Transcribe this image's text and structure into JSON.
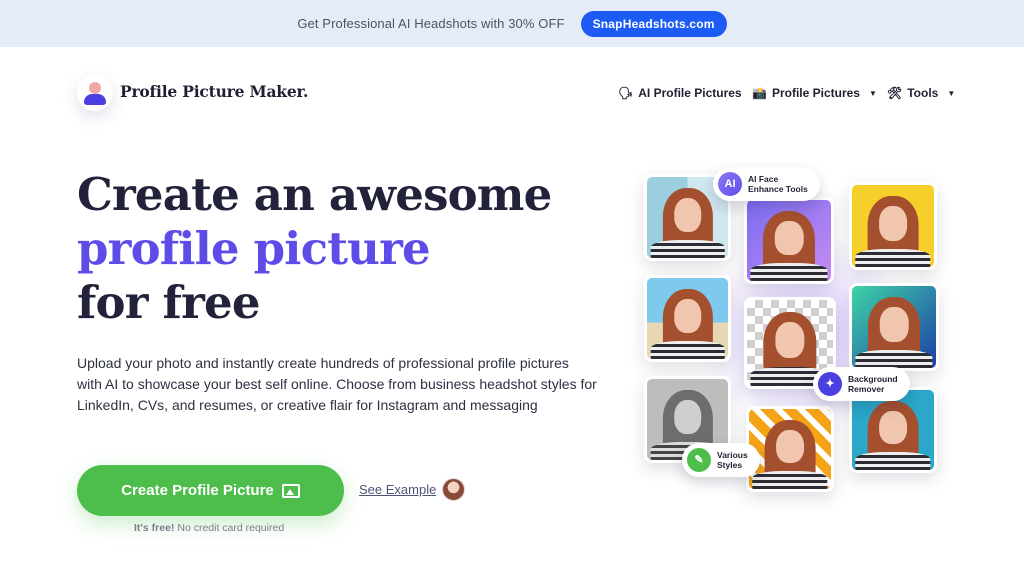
{
  "promo": {
    "text": "Get Professional AI Headshots with 30% OFF",
    "button": "SnapHeadshots.com"
  },
  "brand": {
    "name": "Profile Picture Maker."
  },
  "nav": [
    {
      "icon": "ai-head-icon",
      "glyph": "🗣",
      "label": "AI Profile Pictures",
      "has_caret": false
    },
    {
      "icon": "camera-icon",
      "glyph": "📸",
      "label": "Profile Pictures",
      "has_caret": true
    },
    {
      "icon": "tools-icon",
      "glyph": "🛠",
      "label": "Tools",
      "has_caret": true
    }
  ],
  "hero": {
    "title_line1": "Create an awesome",
    "title_line2": "profile picture",
    "title_line3": "for free",
    "description": "Upload your photo and instantly create hundreds of professional profile pictures with AI to showcase your best self online. Choose from business headshot styles for LinkedIn, CVs, and resumes, or creative flair for Instagram and messaging",
    "cta_label": "Create Profile Picture",
    "see_example": "See Example",
    "free_strong": "It's free!",
    "free_rest": "No credit card required"
  },
  "collage": {
    "tag_ai": {
      "badge": "AI",
      "line1": "AI Face",
      "line2": "Enhance Tools"
    },
    "tag_bg": {
      "line1": "Background",
      "line2": "Remover"
    },
    "tag_styles": {
      "line1": "Various",
      "line2": "Styles"
    }
  },
  "colors": {
    "accent": "#5d4ce8",
    "cta_green": "#4dbd4b",
    "promo_button": "#1c5cf5"
  }
}
